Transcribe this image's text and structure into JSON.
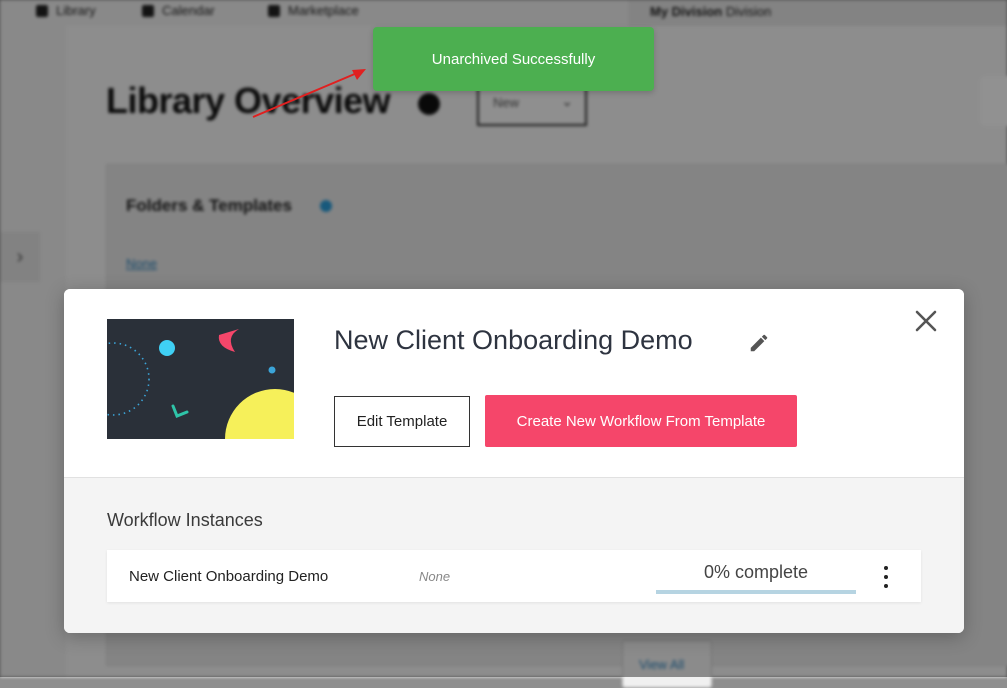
{
  "nav": {
    "items": [
      {
        "label": "Library",
        "icon": "book-icon"
      },
      {
        "label": "Calendar",
        "icon": "calendar-icon"
      },
      {
        "label": "Marketplace",
        "icon": "store-icon"
      }
    ],
    "division_bold": "My Division",
    "division_rest": "Division"
  },
  "background": {
    "page_title": "Library Overview",
    "select_value": "New",
    "card_title": "Folders & Templates",
    "link": "None",
    "view_all": "View All"
  },
  "toast": {
    "message": "Unarchived Successfully",
    "color": "#4caf50"
  },
  "modal": {
    "title": "New Client Onboarding Demo",
    "edit_button": "Edit Template",
    "create_button": "Create New Workflow From Template",
    "accent_color": "#f5466a",
    "section_title": "Workflow Instances",
    "instances": [
      {
        "name": "New Client Onboarding Demo",
        "assignee": "None",
        "progress_label": "0% complete",
        "progress": 0
      }
    ]
  }
}
